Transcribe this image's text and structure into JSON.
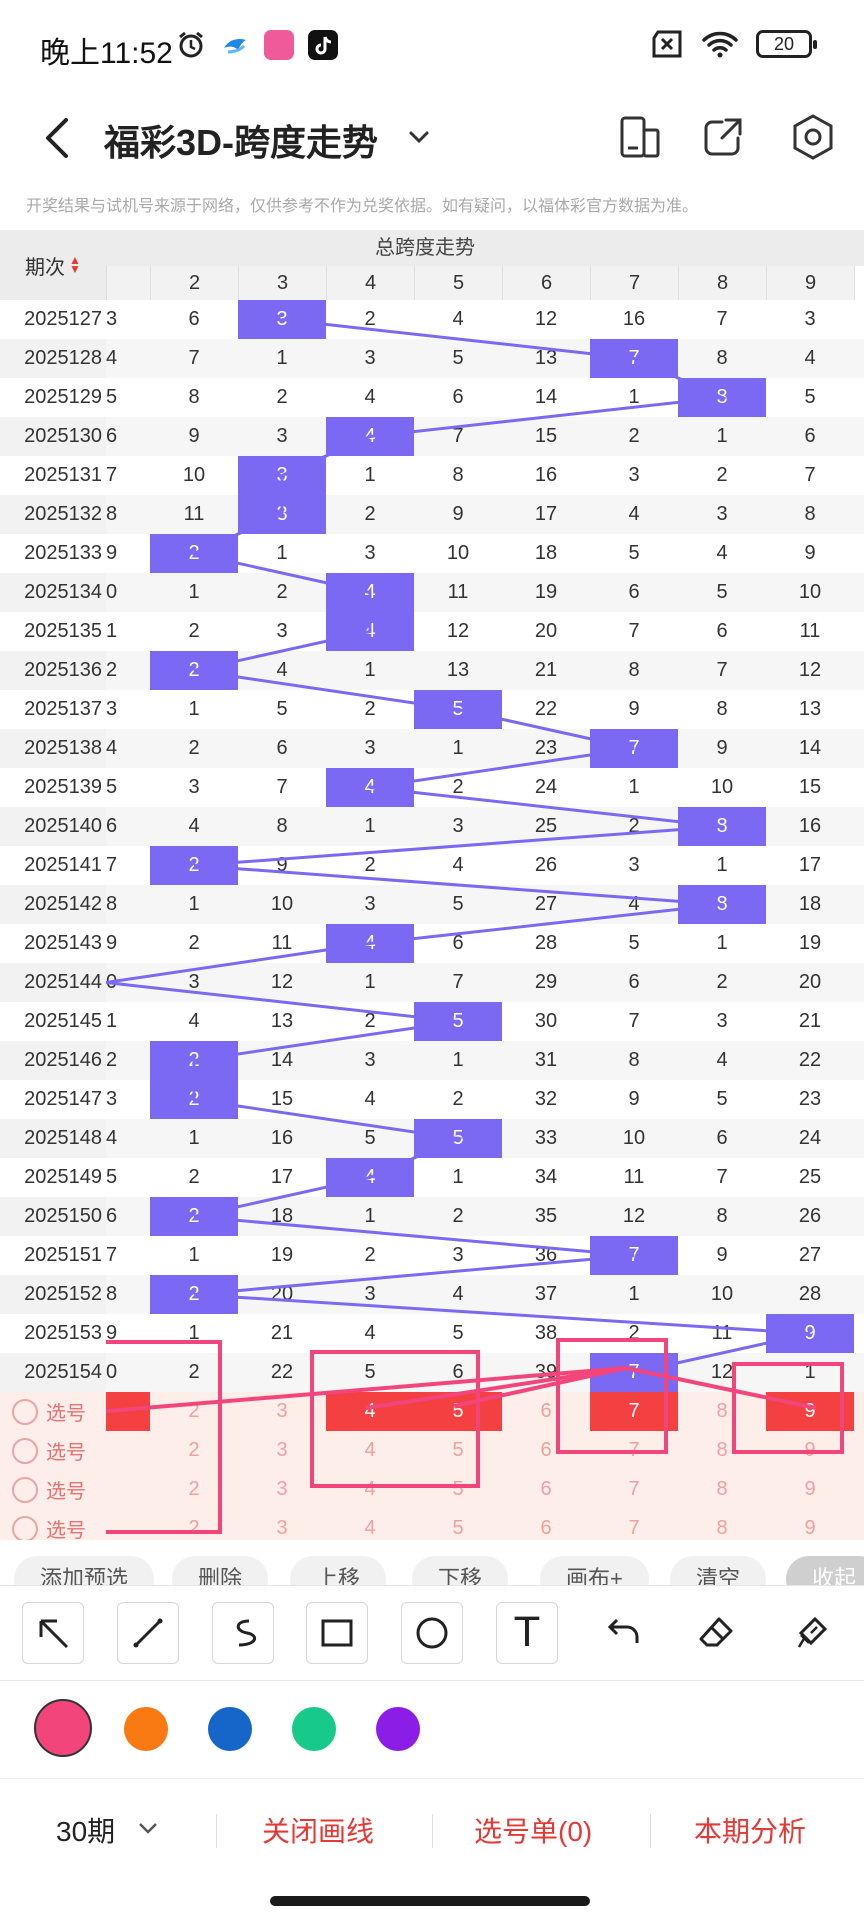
{
  "status": {
    "time": "晚上11:52",
    "battery": "20"
  },
  "header": {
    "title": "福彩3D-跨度走势",
    "disclaimer": "开奖结果与试机号来源于网络，仅供参考不作为兑奖依据。如有疑问，以福体彩官方数据为准。"
  },
  "table": {
    "issue_header": "期次",
    "group_title": "总跨度走势",
    "columns": [
      "2",
      "3",
      "4",
      "5",
      "6",
      "7",
      "8",
      "9"
    ],
    "first_col_partial": [
      "3",
      "4",
      "5",
      "6",
      "7",
      "8",
      "9",
      "0",
      "1",
      "2",
      "3",
      "4",
      "5",
      "6",
      "7",
      "8",
      "9",
      "0",
      "1",
      "2",
      "3",
      "4",
      "5",
      "6",
      "7",
      "8",
      "9",
      "0"
    ],
    "rows": [
      {
        "issue": "2025127",
        "cells": [
          "6",
          "3",
          "2",
          "4",
          "12",
          "16",
          "7",
          "3"
        ],
        "hit": 3
      },
      {
        "issue": "2025128",
        "cells": [
          "7",
          "1",
          "3",
          "5",
          "13",
          "7",
          "8",
          "4"
        ],
        "hit": 7
      },
      {
        "issue": "2025129",
        "cells": [
          "8",
          "2",
          "4",
          "6",
          "14",
          "1",
          "8",
          "5"
        ],
        "hit": 8
      },
      {
        "issue": "2025130",
        "cells": [
          "9",
          "3",
          "4",
          "7",
          "15",
          "2",
          "1",
          "6"
        ],
        "hit": 4
      },
      {
        "issue": "2025131",
        "cells": [
          "10",
          "3",
          "1",
          "8",
          "16",
          "3",
          "2",
          "7"
        ],
        "hit": 3
      },
      {
        "issue": "2025132",
        "cells": [
          "11",
          "3",
          "2",
          "9",
          "17",
          "4",
          "3",
          "8"
        ],
        "hit": 3
      },
      {
        "issue": "2025133",
        "cells": [
          "2",
          "1",
          "3",
          "10",
          "18",
          "5",
          "4",
          "9"
        ],
        "hit": 2
      },
      {
        "issue": "2025134",
        "cells": [
          "1",
          "2",
          "4",
          "11",
          "19",
          "6",
          "5",
          "10"
        ],
        "hit": 4
      },
      {
        "issue": "2025135",
        "cells": [
          "2",
          "3",
          "4",
          "12",
          "20",
          "7",
          "6",
          "11"
        ],
        "hit": 4
      },
      {
        "issue": "2025136",
        "cells": [
          "2",
          "4",
          "1",
          "13",
          "21",
          "8",
          "7",
          "12"
        ],
        "hit": 2
      },
      {
        "issue": "2025137",
        "cells": [
          "1",
          "5",
          "2",
          "5",
          "22",
          "9",
          "8",
          "13"
        ],
        "hit": 5
      },
      {
        "issue": "2025138",
        "cells": [
          "2",
          "6",
          "3",
          "1",
          "23",
          "7",
          "9",
          "14"
        ],
        "hit": 7
      },
      {
        "issue": "2025139",
        "cells": [
          "3",
          "7",
          "4",
          "2",
          "24",
          "1",
          "10",
          "15"
        ],
        "hit": 4
      },
      {
        "issue": "2025140",
        "cells": [
          "4",
          "8",
          "1",
          "3",
          "25",
          "2",
          "8",
          "16"
        ],
        "hit": 8
      },
      {
        "issue": "2025141",
        "cells": [
          "2",
          "9",
          "2",
          "4",
          "26",
          "3",
          "1",
          "17"
        ],
        "hit": 2
      },
      {
        "issue": "2025142",
        "cells": [
          "1",
          "10",
          "3",
          "5",
          "27",
          "4",
          "8",
          "18"
        ],
        "hit": 8
      },
      {
        "issue": "2025143",
        "cells": [
          "2",
          "11",
          "4",
          "6",
          "28",
          "5",
          "1",
          "19"
        ],
        "hit": 4
      },
      {
        "issue": "2025144",
        "cells": [
          "3",
          "12",
          "1",
          "7",
          "29",
          "6",
          "2",
          "20"
        ],
        "hit": 0
      },
      {
        "issue": "2025145",
        "cells": [
          "4",
          "13",
          "2",
          "5",
          "30",
          "7",
          "3",
          "21"
        ],
        "hit": 5
      },
      {
        "issue": "2025146",
        "cells": [
          "2",
          "14",
          "3",
          "1",
          "31",
          "8",
          "4",
          "22"
        ],
        "hit": 2
      },
      {
        "issue": "2025147",
        "cells": [
          "2",
          "15",
          "4",
          "2",
          "32",
          "9",
          "5",
          "23"
        ],
        "hit": 2
      },
      {
        "issue": "2025148",
        "cells": [
          "1",
          "16",
          "5",
          "5",
          "33",
          "10",
          "6",
          "24"
        ],
        "hit": 5
      },
      {
        "issue": "2025149",
        "cells": [
          "2",
          "17",
          "4",
          "1",
          "34",
          "11",
          "7",
          "25"
        ],
        "hit": 4
      },
      {
        "issue": "2025150",
        "cells": [
          "2",
          "18",
          "1",
          "2",
          "35",
          "12",
          "8",
          "26"
        ],
        "hit": 2
      },
      {
        "issue": "2025151",
        "cells": [
          "1",
          "19",
          "2",
          "3",
          "36",
          "7",
          "9",
          "27"
        ],
        "hit": 7
      },
      {
        "issue": "2025152",
        "cells": [
          "2",
          "20",
          "3",
          "4",
          "37",
          "1",
          "10",
          "28"
        ],
        "hit": 2
      },
      {
        "issue": "2025153",
        "cells": [
          "1",
          "21",
          "4",
          "5",
          "38",
          "2",
          "11",
          "9"
        ],
        "hit": 9
      },
      {
        "issue": "2025154",
        "cells": [
          "2",
          "22",
          "5",
          "6",
          "39",
          "7",
          "12",
          "1"
        ],
        "hit": 7
      }
    ],
    "pick_label": "选号",
    "pick_rows": [
      {
        "on": [
          "4",
          "5",
          "7",
          "9"
        ],
        "partial_on": true
      },
      {
        "on": [],
        "partial_on": false
      },
      {
        "on": [],
        "partial_on": false
      },
      {
        "on": [],
        "partial_on": false
      }
    ]
  },
  "chips": [
    "添加预选",
    "删除",
    "上移",
    "下移",
    "画布+",
    "清空",
    "收起"
  ],
  "tools": [
    "arrow-tool",
    "line-tool",
    "curve-tool",
    "rect-tool",
    "circle-tool",
    "text-tool",
    "undo-tool",
    "eraser-tool",
    "clear-tool"
  ],
  "text_tool_glyph": "T",
  "palette": [
    "#f2457c",
    "#f97a12",
    "#1566c8",
    "#17c98a",
    "#8c1de6"
  ],
  "bottom": {
    "period": "30期",
    "close_lines": "关闭画线",
    "pick_list": "选号单(0)",
    "analysis": "本期分析"
  }
}
